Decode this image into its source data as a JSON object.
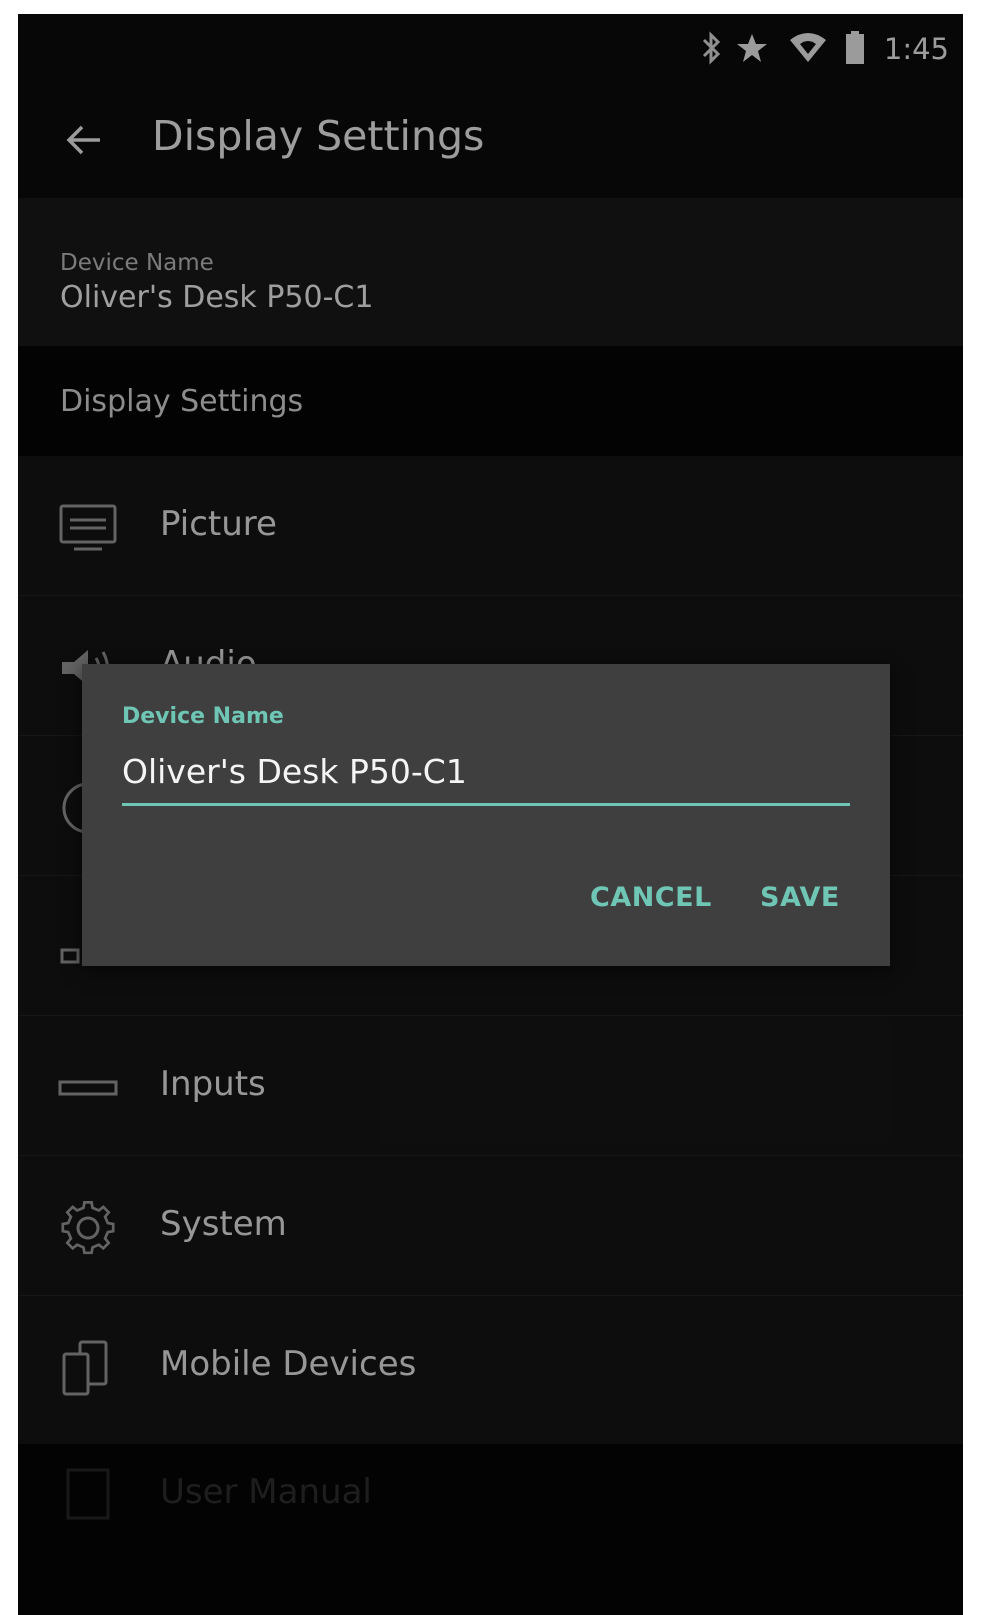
{
  "status_bar": {
    "time": "1:45",
    "icons": [
      "bluetooth-icon",
      "star-icon",
      "wifi-icon",
      "battery-icon"
    ]
  },
  "app_bar": {
    "title": "Display Settings",
    "back_icon": "back-arrow-icon"
  },
  "device": {
    "label": "Device Name",
    "value": "Oliver's Desk P50-C1"
  },
  "section": {
    "header": "Display Settings"
  },
  "menu": {
    "items": [
      {
        "label": "Picture",
        "icon": "picture-icon"
      },
      {
        "label": "Audio",
        "icon": "audio-icon"
      },
      {
        "label": "",
        "icon": "timers-icon"
      },
      {
        "label": "",
        "icon": "network-icon"
      },
      {
        "label": "Inputs",
        "icon": "inputs-icon"
      },
      {
        "label": "System",
        "icon": "gear-icon"
      },
      {
        "label": "Mobile Devices",
        "icon": "mobile-devices-icon"
      },
      {
        "label": "User Manual",
        "icon": "manual-icon"
      }
    ]
  },
  "dialog": {
    "label": "Device Name",
    "input_value": "Oliver's Desk P50-C1",
    "cancel_label": "CANCEL",
    "save_label": "SAVE"
  },
  "colors": {
    "accent": "#6fc6b5",
    "background": "#151515",
    "dialog": "#3f3f3f"
  }
}
